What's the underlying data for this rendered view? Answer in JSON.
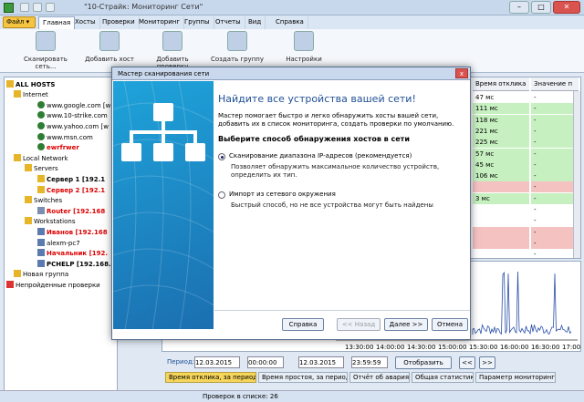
{
  "window": {
    "title": "\"10-Страйк: Мониторинг Сети\""
  },
  "menu": {
    "file": "Файл",
    "tabs": [
      "Главная",
      "Хосты",
      "Проверки",
      "Мониторинг",
      "Группы",
      "Отчеты",
      "Вид",
      "Справка"
    ]
  },
  "ribbon": {
    "buttons": [
      "Сканировать сеть...",
      "Добавить хост",
      "Добавить проверку",
      "Создать группу",
      "Настройки"
    ]
  },
  "tree": {
    "items": [
      {
        "label": "ALL HOSTS",
        "kind": "folder",
        "indent": 0
      },
      {
        "label": "Internet",
        "kind": "folder",
        "indent": 1
      },
      {
        "label": "www.google.com [w",
        "kind": "globe",
        "indent": 2
      },
      {
        "label": "www.10-strike.com",
        "kind": "globe",
        "indent": 2
      },
      {
        "label": "www.yahoo.com [w",
        "kind": "globe",
        "indent": 2
      },
      {
        "label": "www.msn.com",
        "kind": "globe",
        "indent": 2
      },
      {
        "label": "ewrfrwer",
        "kind": "globe-red",
        "indent": 2
      },
      {
        "label": "Local Network",
        "kind": "folder",
        "indent": 1
      },
      {
        "label": "Servers",
        "kind": "folder",
        "indent": 2
      },
      {
        "label": "Сервер 1 [192.1",
        "kind": "server",
        "indent": 3
      },
      {
        "label": "Сервер 2 [192.1",
        "kind": "server-red",
        "indent": 3
      },
      {
        "label": "Switches",
        "kind": "folder",
        "indent": 2
      },
      {
        "label": "Router [192.168",
        "kind": "server-red",
        "indent": 3
      },
      {
        "label": "Workstations",
        "kind": "folder",
        "indent": 2
      },
      {
        "label": "Иванов [192.168",
        "kind": "pc-red",
        "indent": 3
      },
      {
        "label": "alexm-pc7",
        "kind": "pc",
        "indent": 3
      },
      {
        "label": "Начальник [192.",
        "kind": "pc-red",
        "indent": 3
      },
      {
        "label": "PCHELP [192.168.",
        "kind": "pc",
        "indent": 3
      },
      {
        "label": "Новая группа",
        "kind": "folder",
        "indent": 1
      },
      {
        "label": "Непройденные проверки",
        "kind": "folder-red",
        "indent": 0
      }
    ]
  },
  "grid": {
    "headers": [
      "Время отклика",
      "Значение п"
    ],
    "rows": [
      {
        "resp": "47 мс",
        "val": "-",
        "color": "white"
      },
      {
        "resp": "111 мс",
        "val": "-",
        "color": "green"
      },
      {
        "resp": "118 мс",
        "val": "-",
        "color": "green"
      },
      {
        "resp": "221 мс",
        "val": "-",
        "color": "green"
      },
      {
        "resp": "225 мс",
        "val": "-",
        "color": "green"
      },
      {
        "resp": "57 мс",
        "val": "-",
        "color": "green"
      },
      {
        "resp": "45 мс",
        "val": "-",
        "color": "green"
      },
      {
        "resp": "106 мс",
        "val": "-",
        "color": "green"
      },
      {
        "resp": "",
        "val": "-",
        "color": "pink"
      },
      {
        "resp": "3 мс",
        "val": "-",
        "color": "green"
      },
      {
        "resp": "",
        "val": "-",
        "color": "white"
      },
      {
        "resp": "",
        "val": "-",
        "color": "white"
      },
      {
        "resp": "",
        "val": "-",
        "color": "pink"
      },
      {
        "resp": "",
        "val": "-",
        "color": "pink"
      },
      {
        "resp": "",
        "val": "-",
        "color": "white"
      }
    ]
  },
  "chart": {
    "ticks": [
      "13:30:00",
      "14:00:00",
      "14:30:00",
      "15:00:00",
      "15:30:00",
      "16:00:00",
      "16:30:00",
      "17:00:00"
    ]
  },
  "period": {
    "label": "Период:",
    "date_from": "12.03.2015",
    "time_from": "00:00:00",
    "date_to": "12.03.2015",
    "time_to": "23:59:59",
    "show": "Отобразить",
    "prev": "<<",
    "next": ">>"
  },
  "bottom_tabs": [
    "Время отклика, за период",
    "Время простоя, за период",
    "Отчёт об авариях",
    "Общая статистика",
    "Параметр мониторинга"
  ],
  "status": {
    "text": "Проверок в списке: 26"
  },
  "dialog": {
    "title": "Мастер сканирования сети",
    "close": "x",
    "heading": "Найдите все устройства вашей сети!",
    "intro": "Мастер помогает быстро и легко обнаружить хосты вашей сети, добавить их в список мониторинга, создать проверки по умолчанию.",
    "choose": "Выберите способ обнаружения хостов в сети",
    "option1": "Сканирование диапазона IP-адресов (рекомендуется)",
    "option1_desc": "Позволяет обнаружить максимальное количество устройств, определить их тип.",
    "option2": "Импорт из сетевого окружения",
    "option2_desc": "Быстрый способ, но не все устройства могут быть найдены",
    "btn_help": "Справка",
    "btn_back": "<< Назад",
    "btn_next": "Далее >>",
    "btn_cancel": "Отмена"
  }
}
